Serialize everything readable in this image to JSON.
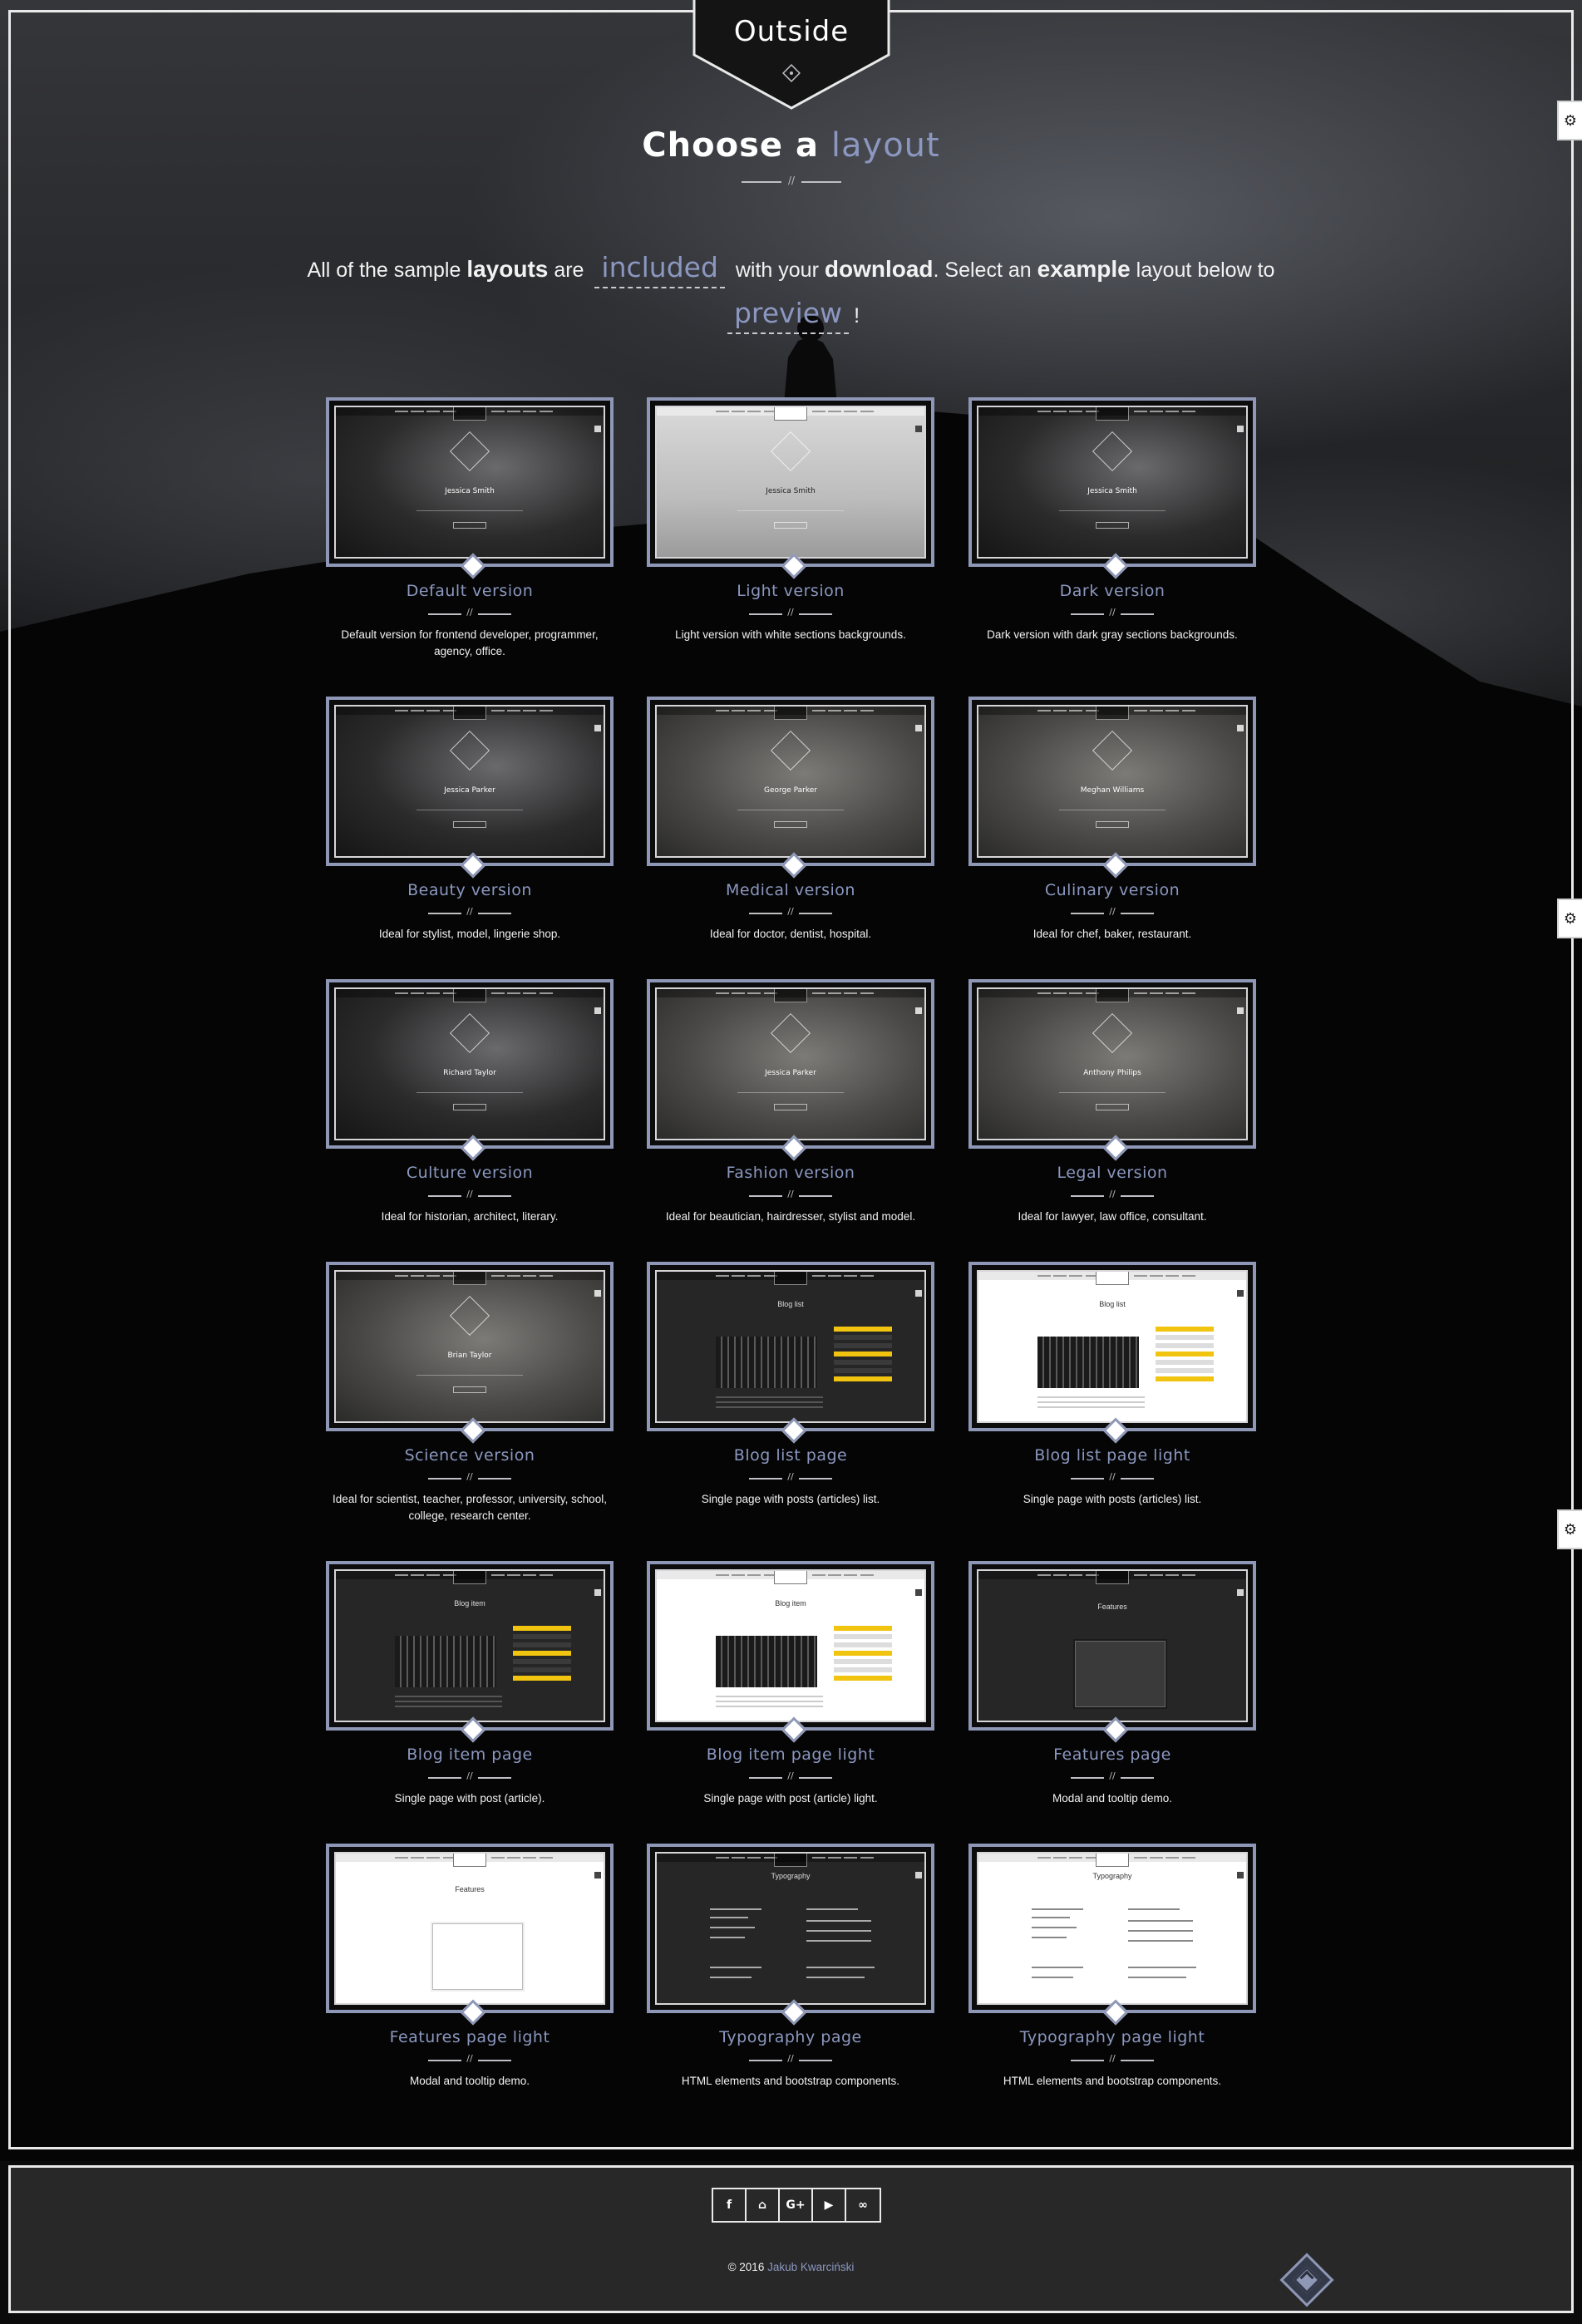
{
  "brand": {
    "logo_text": "Outside"
  },
  "heading": {
    "prefix": "Choose a",
    "accent": "layout"
  },
  "intro": {
    "t1": "All of the sample",
    "b1": "layouts",
    "t2": "are",
    "hl1": "included",
    "t3": "with your",
    "b2": "download",
    "t4": ". Select an",
    "b3": "example",
    "t5": "layout below to",
    "hl2": "preview",
    "t6": "!"
  },
  "divider_mark": "//",
  "card_divider_mark": "//",
  "icons": {
    "settings": "gear-icon",
    "scroll_top": "chevron-up-icon"
  },
  "layouts": [
    {
      "title": "Default version",
      "desc": "Default version for frontend developer, programmer, agency, office.",
      "name": "Jessica Smith",
      "style": "dark-photo"
    },
    {
      "title": "Light version",
      "desc": "Light version with white sections backgrounds.",
      "name": "Jessica Smith",
      "style": "light-photo"
    },
    {
      "title": "Dark version",
      "desc": "Dark version with dark gray sections backgrounds.",
      "name": "Jessica Smith",
      "style": "dark-photo"
    },
    {
      "title": "Beauty version",
      "desc": "Ideal for stylist, model, lingerie shop.",
      "name": "Jessica Parker",
      "style": "dark-photo"
    },
    {
      "title": "Medical version",
      "desc": "Ideal for doctor, dentist, hospital.",
      "name": "George Parker",
      "style": "gray-photo"
    },
    {
      "title": "Culinary version",
      "desc": "Ideal for chef, baker, restaurant.",
      "name": "Meghan Williams",
      "style": "gray-photo"
    },
    {
      "title": "Culture version",
      "desc": "Ideal for historian, architect, literary.",
      "name": "Richard Taylor",
      "style": "dark-photo"
    },
    {
      "title": "Fashion version",
      "desc": "Ideal for beautician, hairdresser, stylist and model.",
      "name": "Jessica Parker",
      "style": "gray-photo"
    },
    {
      "title": "Legal version",
      "desc": "Ideal for lawyer, law office, consultant.",
      "name": "Anthony Philips",
      "style": "gray-photo"
    },
    {
      "title": "Science version",
      "desc": "Ideal for scientist, teacher, professor, university, school, college, research center.",
      "name": "Brian Taylor",
      "style": "gray-photo"
    },
    {
      "title": "Blog list page",
      "desc": "Single page with posts (articles) list.",
      "name": "Blog list",
      "style": "blog-dark"
    },
    {
      "title": "Blog list page light",
      "desc": "Single page with posts (articles) list.",
      "name": "Blog list",
      "style": "blog-light"
    },
    {
      "title": "Blog item page",
      "desc": "Single page with post (article).",
      "name": "Blog item",
      "style": "blog-dark"
    },
    {
      "title": "Blog item page light",
      "desc": "Single page with post (article) light.",
      "name": "Blog item",
      "style": "blog-light"
    },
    {
      "title": "Features page",
      "desc": "Modal and tooltip demo.",
      "name": "Features",
      "style": "feat-dark"
    },
    {
      "title": "Features page light",
      "desc": "Modal and tooltip demo.",
      "name": "Features",
      "style": "feat-light"
    },
    {
      "title": "Typography page",
      "desc": "HTML elements and bootstrap components.",
      "name": "Typography",
      "style": "typo-dark"
    },
    {
      "title": "Typography page light",
      "desc": "HTML elements and bootstrap components.",
      "name": "Typography",
      "style": "typo-light"
    }
  ],
  "footer": {
    "social": [
      {
        "label": "f",
        "icon": "facebook-icon"
      },
      {
        "label": "⌂",
        "icon": "github-icon"
      },
      {
        "label": "G+",
        "icon": "google-plus-icon"
      },
      {
        "label": "▶",
        "icon": "youtube-icon"
      },
      {
        "label": "∞",
        "icon": "lastfm-icon"
      }
    ],
    "copyright_prefix": "© 2016",
    "author": "Jakub Kwarciński"
  },
  "colors": {
    "accent": "#8b97bf",
    "thumb_border": "#8e97b5",
    "highlight_yellow": "#f1c40f"
  }
}
